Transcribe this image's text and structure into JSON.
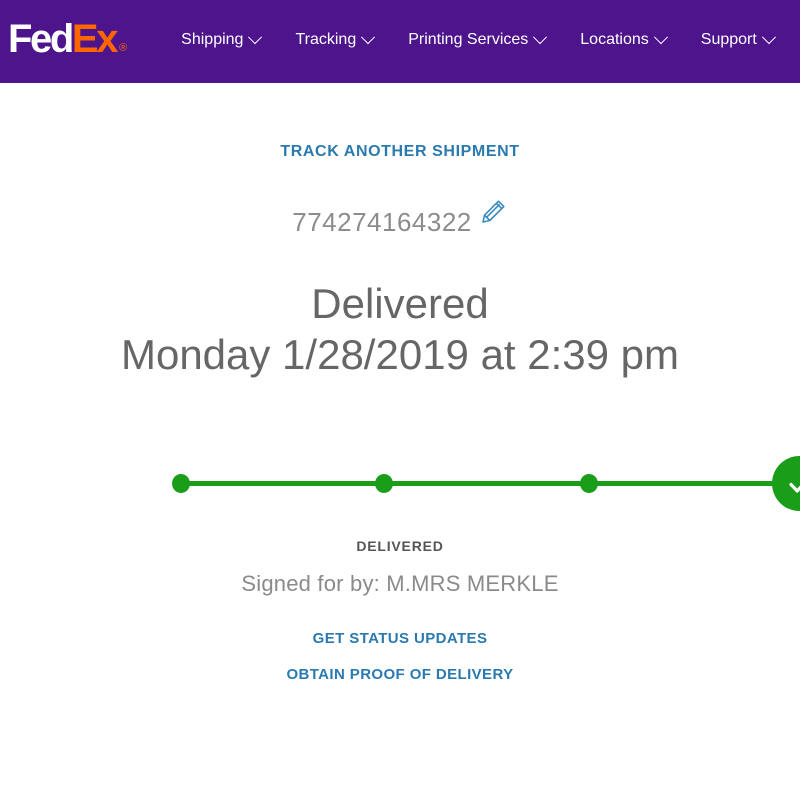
{
  "brand": {
    "logo_fed": "Fed",
    "logo_ex": "Ex",
    "logo_reg": "®",
    "purple": "#4D148C",
    "orange": "#FF6600",
    "link_blue": "#2A7AB0",
    "green": "#1A9E1A"
  },
  "nav": {
    "items": [
      {
        "label": "Shipping",
        "icon": "chevron-down-icon"
      },
      {
        "label": "Tracking",
        "icon": "chevron-down-icon"
      },
      {
        "label": "Printing Services",
        "icon": "chevron-down-icon"
      },
      {
        "label": "Locations",
        "icon": "chevron-down-icon"
      },
      {
        "label": "Support",
        "icon": "chevron-down-icon"
      }
    ]
  },
  "main": {
    "track_another_label": "TRACK ANOTHER SHIPMENT",
    "tracking_number": "774274164322",
    "edit_icon": "pencil-icon",
    "status_title": "Delivered",
    "status_date": "Monday 1/28/2019 at 2:39 pm",
    "progress": {
      "steps": [
        {
          "label": "",
          "state": "complete"
        },
        {
          "label": "",
          "state": "complete"
        },
        {
          "label": "",
          "state": "complete"
        }
      ],
      "final_step": {
        "label": "",
        "state": "complete",
        "icon": "check-icon"
      },
      "percent": 100
    },
    "delivered_label": "DELIVERED",
    "signed_for": "Signed for by: M.MRS MERKLE",
    "links": [
      {
        "label": "GET STATUS UPDATES"
      },
      {
        "label": "OBTAIN PROOF OF DELIVERY"
      }
    ]
  }
}
